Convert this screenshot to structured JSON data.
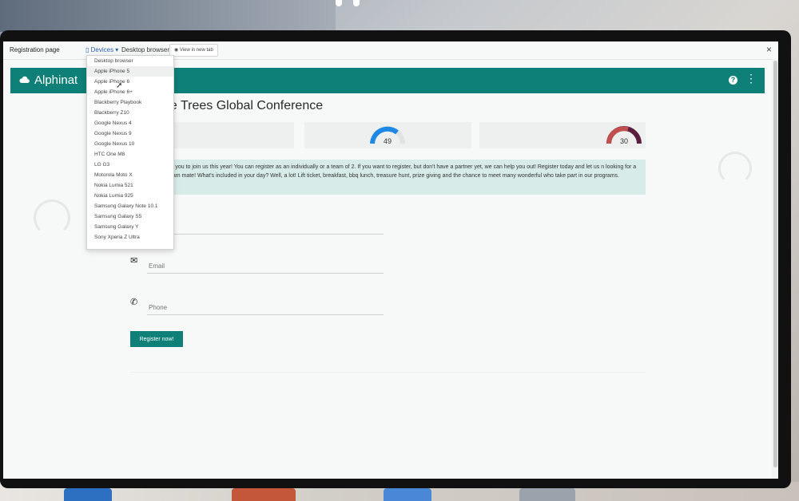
{
  "window": {
    "title": "Registration page",
    "devices_label": "Devices",
    "current_device": "Desktop browser",
    "preview_label": "View in new tab",
    "close_glyph": "×"
  },
  "device_menu": {
    "items": [
      "Desktop browser",
      "Apple iPhone 5",
      "Apple iPhone 6",
      "Apple iPhone 6+",
      "Blackberry Playbook",
      "Blackberry Z10",
      "Google Nexus 4",
      "Google Nexus 9",
      "Google Nexus 10",
      "HTC One M8",
      "LG G3",
      "Motorola Moto X",
      "Nokia Lumia 521",
      "Nokia Lumia 925",
      "Samsung Galaxy Note 10.1",
      "Samsung Galaxy S5",
      "Samsung Galaxy Y",
      "Sony Xperia Z Ultra"
    ],
    "highlighted_index": 1
  },
  "app": {
    "brand": "Alphinat",
    "brand_color": "#0e8077",
    "help_glyph": "?",
    "more_glyph": "⋮"
  },
  "page": {
    "title": "he Trees Global Conference",
    "gauges": [
      {
        "value": "49",
        "color": "#1e88e5"
      },
      {
        "value": "30",
        "color": "#c0504d"
      }
    ],
    "info_text": "ve you to join us this year! You can register as an individually or a team of 2. If you want to register, but don't have a partner yet, we can help you out! Register today and let us n looking for a team mate! What's included in your day? Well, a lot! Lift ticket, breakfast, bbq lunch, treasure hunt, prize giving and the chance to meet many wonderful who take part in our programs.",
    "email_placeholder": "Email",
    "phone_placeholder": "Phone",
    "register_label": "Register now!"
  }
}
